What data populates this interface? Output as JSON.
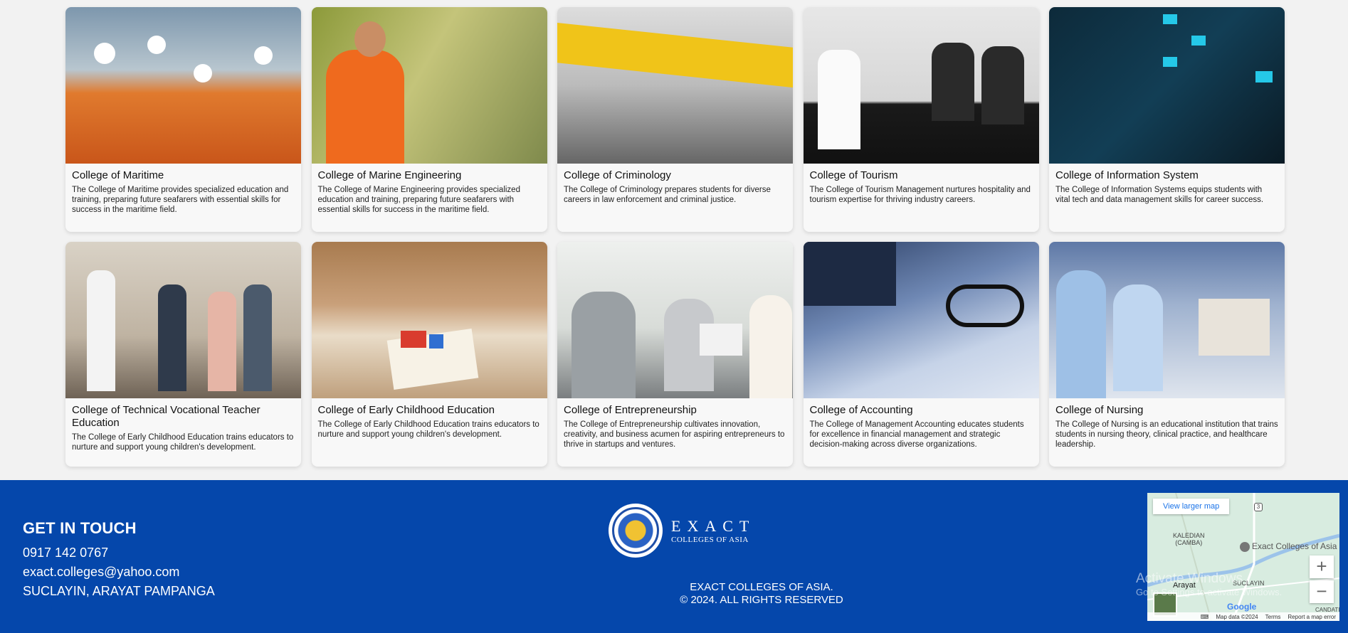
{
  "colleges": [
    {
      "title": "College of Maritime",
      "desc": "The College of Maritime provides specialized education and training, preparing future seafarers with essential skills for success in the maritime field."
    },
    {
      "title": "College of Marine Engineering",
      "desc": "The College of Marine Engineering provides specialized education and training, preparing future seafarers with essential skills for success in the maritime field."
    },
    {
      "title": "College of Criminology",
      "desc": "The College of Criminology prepares students for diverse careers in law enforcement and criminal justice."
    },
    {
      "title": "College of Tourism",
      "desc": "The College of Tourism Management nurtures hospitality and tourism expertise for thriving industry careers."
    },
    {
      "title": "College of Information System",
      "desc": "The College of Information Systems equips students with vital tech and data management skills for career success."
    },
    {
      "title": "College of Technical Vocational Teacher Education",
      "desc": "The College of Early Childhood Education trains educators to nurture and support young children's development."
    },
    {
      "title": "College of Early Childhood Education",
      "desc": "The College of Early Childhood Education trains educators to nurture and support young children's development."
    },
    {
      "title": "College of Entrepreneurship",
      "desc": "The College of Entrepreneurship cultivates innovation, creativity, and business acumen for aspiring entrepreneurs to thrive in startups and ventures."
    },
    {
      "title": "College of Accounting",
      "desc": "The College of Management Accounting educates students for excellence in financial management and strategic decision-making across diverse organizations."
    },
    {
      "title": "College of Nursing",
      "desc": "The College of Nursing is an educational institution that trains students in nursing theory, clinical practice, and healthcare leadership."
    }
  ],
  "footer": {
    "heading": "GET IN TOUCH",
    "phone": "0917 142 0767",
    "email": "exact.colleges@yahoo.com",
    "address": "SUCLAYIN, ARAYAT PAMPANGA",
    "brand_line1": "EXACT",
    "brand_line2": "COLLEGES OF ASIA",
    "copy_line1": "EXACT COLLEGES OF ASIA.",
    "copy_line2": "© 2024. ALL RIGHTS RESERVED"
  },
  "map": {
    "view_larger": "View larger map",
    "place1": "KALEDIAN\n(CAMBA)",
    "place2": "Exact Colleges of Asia",
    "place3": "Arayat",
    "place4": "SUCLAYIN",
    "place5": "CANDATI",
    "route": "3",
    "zoom_in": "+",
    "zoom_out": "−",
    "google": "Google",
    "attribution": [
      "Map data ©2024",
      "Terms",
      "Report a map error"
    ]
  },
  "watermark": {
    "line1": "Activate Windows",
    "line2": "Go to Settings to activate Windows."
  },
  "image_icons": [
    "seafarers-photo",
    "engineer-photo",
    "crime-scene-photo",
    "front-desk-photo",
    "laptop-data-photo",
    "workshop-photo",
    "classroom-photo",
    "meeting-photo",
    "calculator-photo",
    "nurses-photo"
  ],
  "colors": {
    "footer_bg": "#0547ab",
    "card_bg": "#f8f8f8",
    "page_bg": "#f2f2f2"
  }
}
